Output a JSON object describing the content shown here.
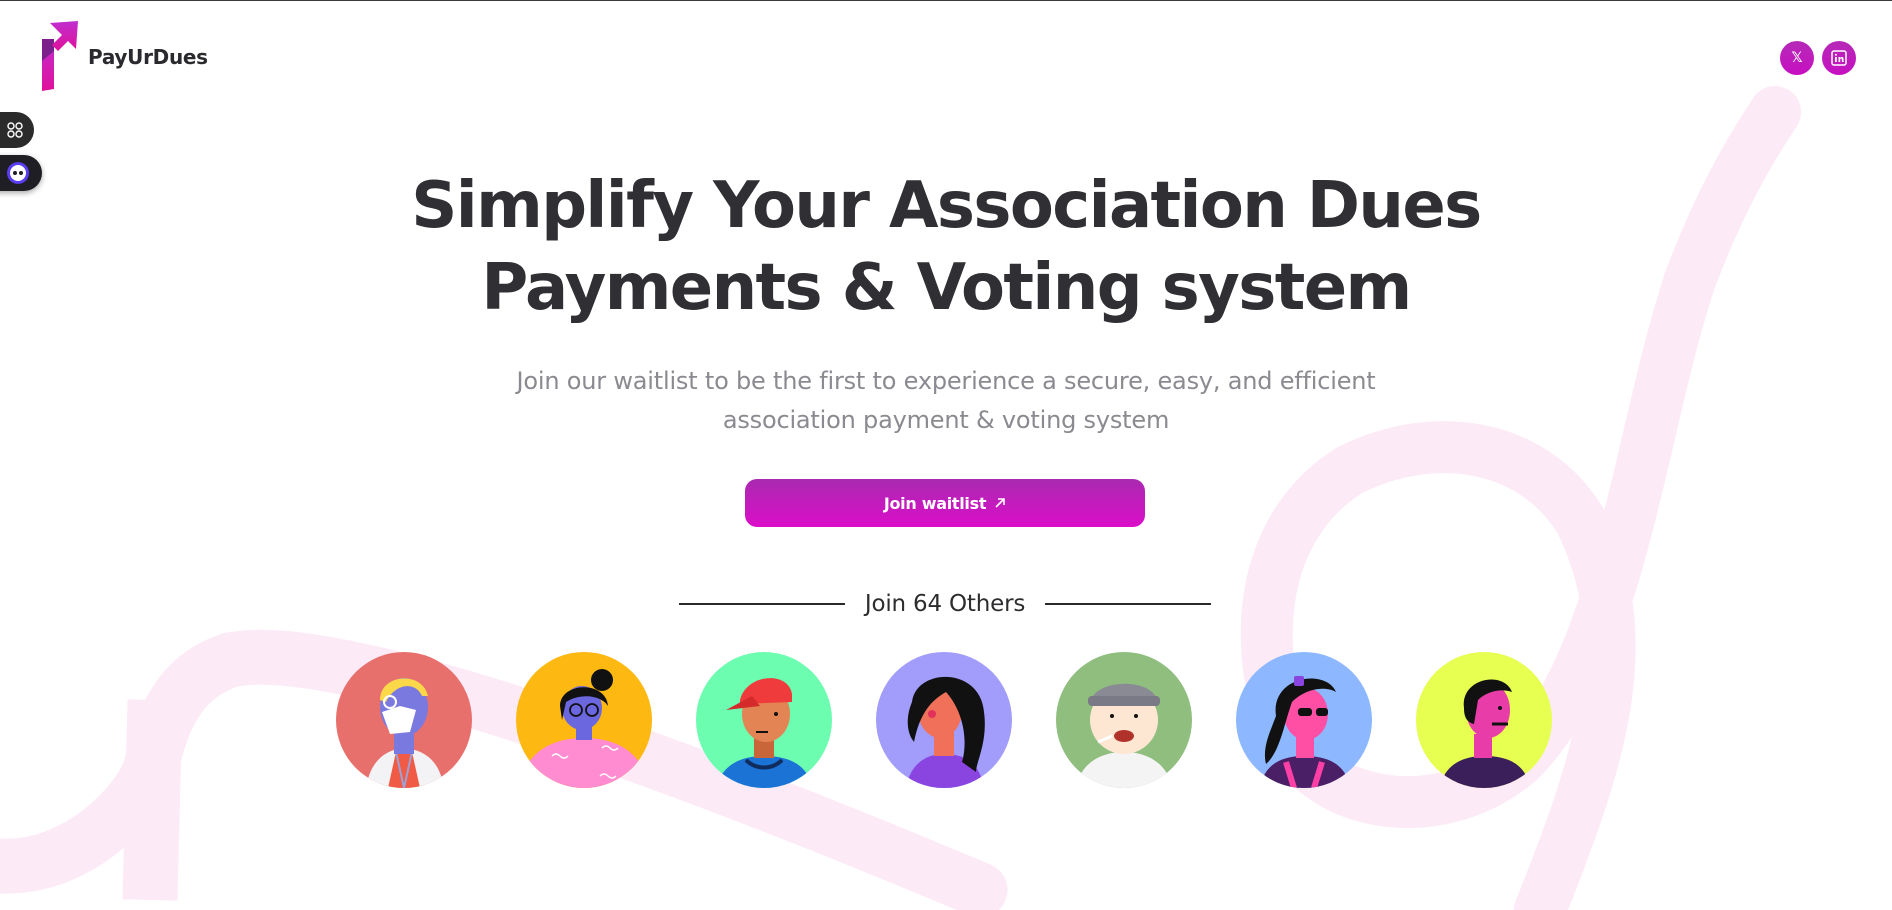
{
  "brand": {
    "name": "PayUrDues",
    "accent_start": "#a92ab0",
    "accent_end": "#db0ec9",
    "swirl_color": "#fdeaf7"
  },
  "header": {
    "social": [
      {
        "name": "x-twitter",
        "glyph": "𝕏"
      },
      {
        "name": "linkedin",
        "glyph": "in"
      }
    ]
  },
  "widgets": {
    "apps_icon": "grid-icon",
    "assistant_icon": "chatbot-icon"
  },
  "hero": {
    "title_line1": "Simplify Your Association Dues",
    "title_line2": "Payments & Voting system",
    "subtitle_line1": "Join our waitlist to be the first to experience a secure, easy, and efficient",
    "subtitle_line2": "association payment & voting system",
    "cta_label": "Join waitlist",
    "cta_icon": "arrow-up-right-icon",
    "join_text": "Join 64 Others"
  },
  "avatars": [
    {
      "name": "avatar-doctor",
      "bg": "#e8706c"
    },
    {
      "name": "avatar-bun-hair",
      "bg": "#fdb812"
    },
    {
      "name": "avatar-red-cap",
      "bg": "#6cfdb0"
    },
    {
      "name": "avatar-long-hair",
      "bg": "#a29cfa"
    },
    {
      "name": "avatar-beanie",
      "bg": "#8fbe7e"
    },
    {
      "name": "avatar-sunglasses",
      "bg": "#8db8ff"
    },
    {
      "name": "avatar-magenta-face",
      "bg": "#e6ff50"
    }
  ]
}
